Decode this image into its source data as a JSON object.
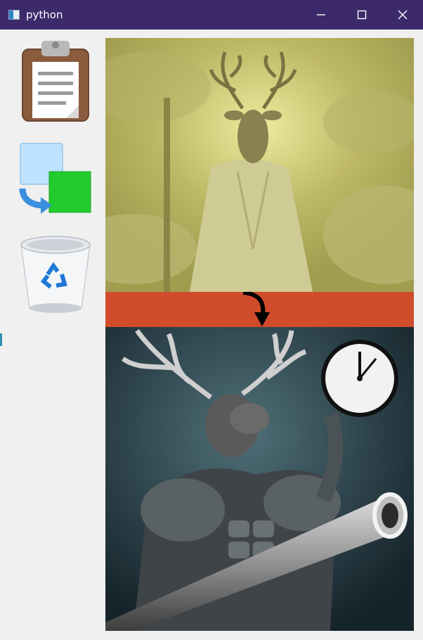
{
  "window": {
    "title": "python",
    "app_icon": "window-app-icon",
    "controls": [
      "minimize-icon",
      "maximize-icon",
      "close-icon"
    ]
  },
  "sidebar": {
    "items": [
      {
        "name": "clipboard",
        "icon": "clipboard-icon"
      },
      {
        "name": "copy",
        "icon": "copy-move-icon"
      },
      {
        "name": "recycle-bin",
        "icon": "recycle-bin-icon"
      }
    ]
  },
  "canvas": {
    "top_image": "deer-deity-image",
    "banner": "transition-banner",
    "bottom_image": "muscular-deer-clock-image",
    "colors": {
      "top_tint": "#a9a556",
      "banner": "#d14c2b",
      "bottom_bg": "#1c2c34"
    }
  }
}
